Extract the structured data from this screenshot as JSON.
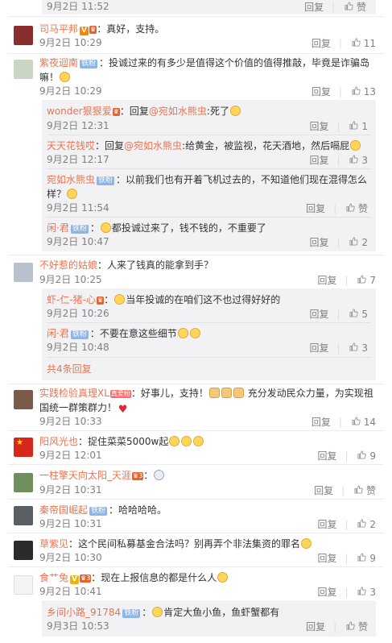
{
  "labels": {
    "reply": "回复",
    "like_icon": "thumbs-up-icon"
  },
  "top_row": {
    "time": "9月2日 11:52",
    "likes": "赞"
  },
  "comments": [
    {
      "user": "司马平邦",
      "text": "：真好，支持。",
      "time": "9月2日 10:29",
      "likes": "11"
    },
    {
      "user": "紫夜迴南",
      "text": "：投诚过来的有多少是值得这个价值的值得推敲，毕竟是诈骗岛",
      "text2": "嘛！",
      "time": "9月2日 10:29",
      "likes": "13"
    },
    {
      "user": "wonder狠狠爱",
      "text_pre": "：回复",
      "mention": "@宛如水熊虫",
      "text": ":死了",
      "time": "9月2日 12:31",
      "likes": "1"
    },
    {
      "user": "天天花钱哎",
      "text_pre": "：回复",
      "mention": "@宛如水熊虫",
      "text": ":给黄金，被监视，花天酒地，然后嗝屁",
      "time": "9月2日 12:17",
      "likes": "3"
    },
    {
      "user": "宛如水熊虫",
      "text": "：以前我们也有开着飞机过去的，不知道他们现在混得怎么",
      "text2": "样？",
      "time": "9月2日 11:54",
      "likes": "赞"
    },
    {
      "user": "闲·君",
      "text": "都投诚过来了，钱不钱的，不重要了",
      "time": "9月2日 10:47",
      "likes": "2"
    },
    {
      "user": "不好惹的姑娘",
      "text": "：人来了钱真的能拿到手？",
      "time": "9月2日 10:25",
      "likes": "7"
    },
    {
      "user": "虾-仁-猪-心",
      "text": "当年投诚的在咱们这不也过得好好的",
      "time": "9月2日 10:26",
      "likes": "5"
    },
    {
      "user": "闲·君",
      "text": "：不要在意这些细节",
      "time": "9月2日 10:48",
      "likes": "3"
    },
    {
      "user": "实践检验真理XL",
      "text": "：好事儿，支持！",
      "text_b": " 充分发动民众力量，为实现祖",
      "text2": "国统一群策群力！",
      "time": "9月2日 10:33",
      "likes": "14"
    },
    {
      "user": "阳风光也",
      "text": "：捉住菜菜5000w起",
      "time": "9月2日 12:01",
      "likes": "9"
    },
    {
      "user": "一柱擎天向太阳_天涯",
      "text": "：",
      "time": "9月2日 10:31",
      "likes": "赞"
    },
    {
      "user": "秦帝国崛起",
      "text": "：哈哈哈哈。",
      "time": "9月2日 10:31",
      "likes": "2"
    },
    {
      "user": "草紫见",
      "text": "：这个民间私募基金合法吗？别再弄个非法集资的罪名",
      "time": "9月2日 10:30",
      "likes": "9"
    },
    {
      "user": "食艹兔",
      "text": "：现在上报信息的都是什么人",
      "time": "9月2日 10:41",
      "likes": "3"
    },
    {
      "user": "乡间小路_91784",
      "text": "肯定大鱼小鱼，鱼虾蟹都有",
      "time": "9月3日 10:53",
      "likes": "赞"
    }
  ],
  "more_replies": "共4条回复",
  "badges": {
    "fan": "铁粉",
    "vip": "V",
    "fan_rank": "真爱粉"
  },
  "colors": {
    "username": "#eb7350",
    "muted": "#808080",
    "subbg": "#f2f2f5"
  }
}
